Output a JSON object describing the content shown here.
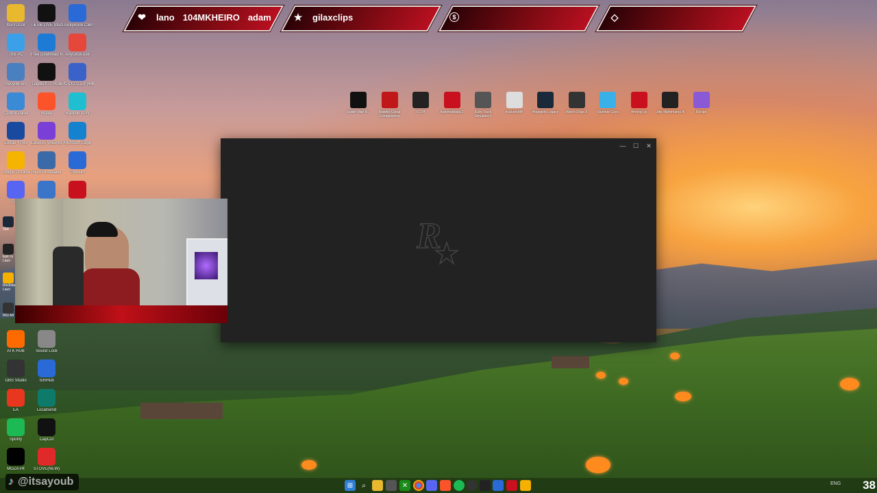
{
  "banner": {
    "slot1": {
      "names": [
        "lano",
        "104MKHEIRO",
        "adam"
      ]
    },
    "slot2": {
      "name": "gilaxclips"
    }
  },
  "desktop_icons": [
    {
      "label": "ItsAYOUB",
      "icon": "folder-icon"
    },
    {
      "label": "TikTok LIVE Studio",
      "icon": "tiktok-icon"
    },
    {
      "label": "TruckyBook Client",
      "icon": "truckybook-icon"
    },
    {
      "label": "This PC",
      "icon": "monitor-icon"
    },
    {
      "label": "Free Download Manager",
      "icon": "download-icon"
    },
    {
      "label": "AnyDesk.exe",
      "icon": "anydesk-icon"
    },
    {
      "label": "Recycle Bin",
      "icon": "recycle-bin-icon"
    },
    {
      "label": "Logitech G HUB",
      "icon": "logitech-icon"
    },
    {
      "label": "PCSX2 0.3.8 (4800)",
      "icon": "pcsx2-icon"
    },
    {
      "label": "Control Panel",
      "icon": "control-panel-icon"
    },
    {
      "label": "Brave",
      "icon": "brave-icon"
    },
    {
      "label": "Radmin VPN",
      "icon": "vpn-icon"
    },
    {
      "label": "Extras + Info",
      "icon": "extras-icon"
    },
    {
      "label": "EaseUS VoiceWave",
      "icon": "voicewave-icon"
    },
    {
      "label": "Microsoft Edge",
      "icon": "edge-icon"
    },
    {
      "label": "Google Chrome",
      "icon": "chrome-icon"
    },
    {
      "label": "Revo Uninstaller",
      "icon": "revo-icon"
    },
    {
      "label": "Thorium",
      "icon": "thorium-icon"
    },
    {
      "label": "Disc",
      "icon": "discord-icon"
    },
    {
      "label": "",
      "icon": "display-icon"
    },
    {
      "label": "",
      "icon": "acrobat-icon"
    },
    {
      "label": "ATK HUB",
      "icon": "atk-icon"
    },
    {
      "label": "Sound Lock",
      "icon": "lock-icon"
    },
    {
      "label": "OBS Studio",
      "icon": "obs-icon"
    },
    {
      "label": "SimHub",
      "icon": "simhub-icon"
    },
    {
      "label": "EA",
      "icon": "ea-icon"
    },
    {
      "label": "LocalSend",
      "icon": "localsend-icon"
    },
    {
      "label": "Spotify",
      "icon": "spotify-icon"
    },
    {
      "label": "CapCut",
      "icon": "capcut-icon"
    },
    {
      "label": "MOZA Pit",
      "icon": "moza-icon"
    },
    {
      "label": "STOVE(NEW)",
      "icon": "stove-icon"
    }
  ],
  "side_clipped": [
    "Ste",
    "Epic G Laun",
    "Rockstar Laun",
    "MSI Aft"
  ],
  "game_icons": [
    {
      "label": "Spider-Man R..."
    },
    {
      "label": "Assetto Corsa Competizione"
    },
    {
      "label": "F1 24"
    },
    {
      "label": "Automobilista 2"
    },
    {
      "label": "Euro Truck Simulator 2"
    },
    {
      "label": "truckersMP"
    },
    {
      "label": "Hogwarts Legacy"
    },
    {
      "label": "Watch Dogs 2"
    },
    {
      "label": "Stumble Guys"
    },
    {
      "label": "Among Us"
    },
    {
      "label": "Little Nightmares III"
    },
    {
      "label": "Recipe"
    }
  ],
  "launcher_window": {
    "logo": "R★"
  },
  "tiktok_handle": "@itsayoub",
  "tray": {
    "lang": "ENG",
    "corner": "38"
  },
  "colors": {
    "banner_red": "#b81020",
    "window_bg": "#222222",
    "tiktok_pink": "#ff0050"
  }
}
